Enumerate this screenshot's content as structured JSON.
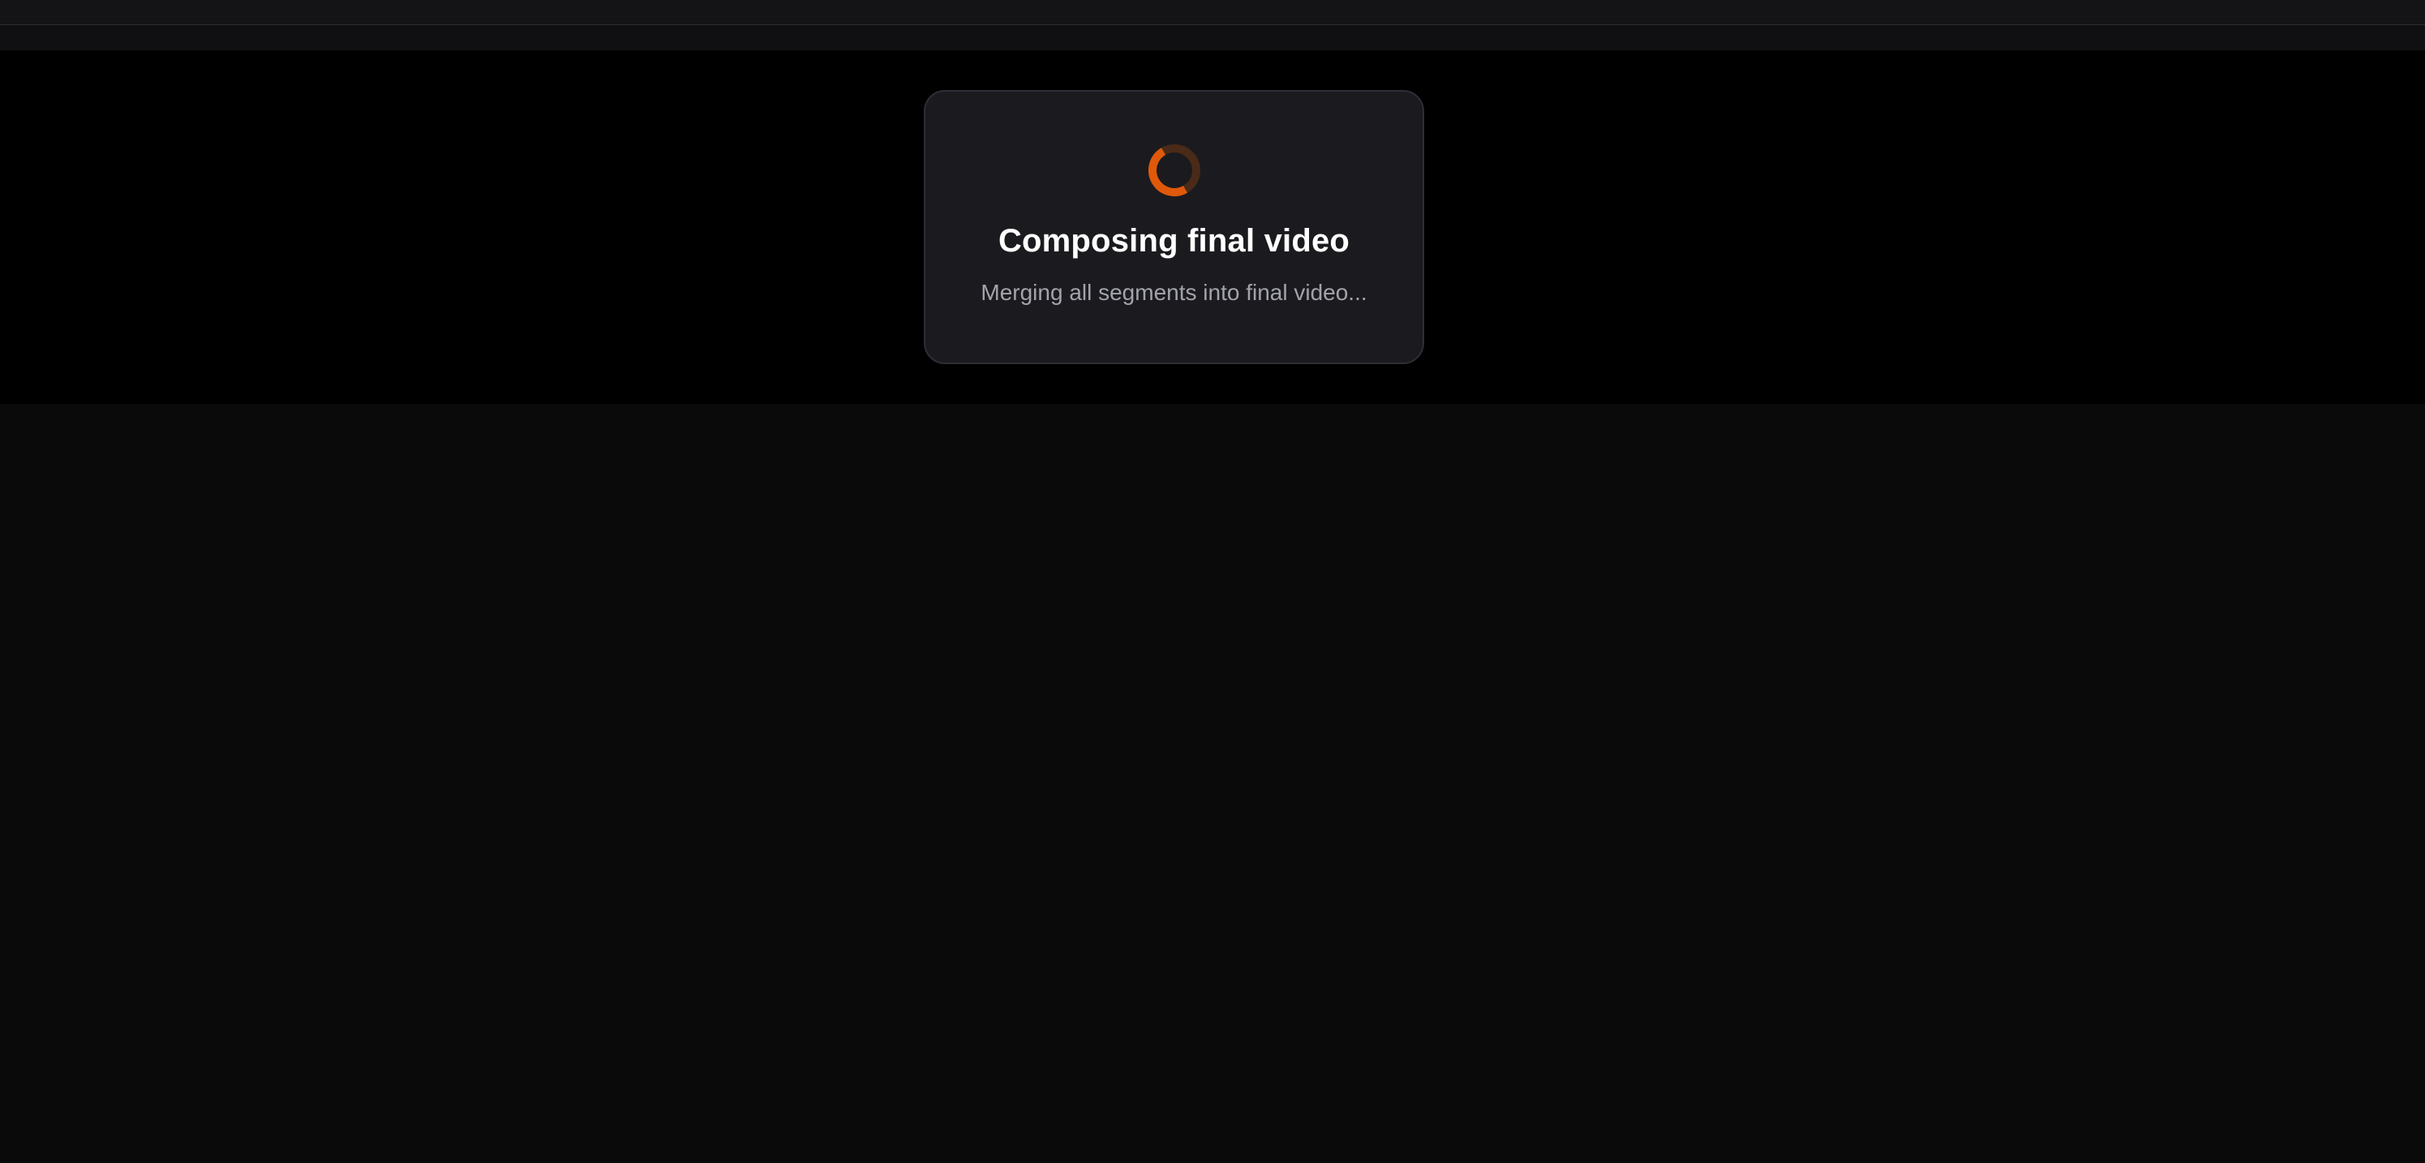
{
  "colors": {
    "accent": "#e0590a",
    "track": "#4a2a18",
    "background": "#0a0a0b",
    "card": "#1b1b1f"
  },
  "status": {
    "icon": "loading-spinner-icon",
    "title": "Composing final video",
    "subtitle": "Merging all segments into final video..."
  }
}
